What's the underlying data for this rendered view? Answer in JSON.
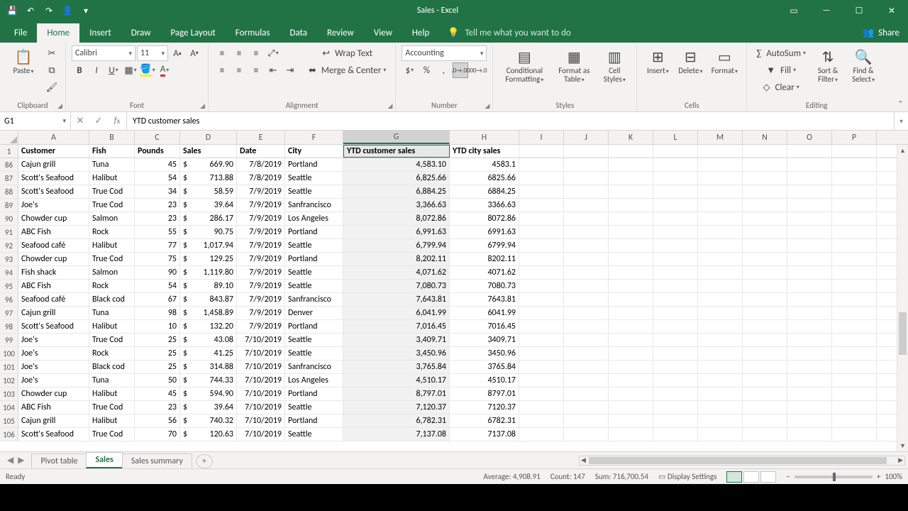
{
  "title": "Sales  -  Excel",
  "qat": {
    "save": "💾",
    "undo": "↶",
    "redo": "↷",
    "user": "👤"
  },
  "winbuttons": {
    "ribbon_opts": "▭",
    "min": "—",
    "max": "☐",
    "close": "✕"
  },
  "tabs": [
    "File",
    "Home",
    "Insert",
    "Draw",
    "Page Layout",
    "Formulas",
    "Data",
    "Review",
    "View",
    "Help"
  ],
  "active_tab": "Home",
  "tell_me": "Tell me what you want to do",
  "share": "Share",
  "ribbon": {
    "clipboard": {
      "label": "Clipboard",
      "paste": "Paste"
    },
    "font": {
      "label": "Font",
      "name": "Calibri",
      "size": "11"
    },
    "alignment": {
      "label": "Alignment",
      "wrap": "Wrap Text",
      "merge": "Merge & Center"
    },
    "number": {
      "label": "Number",
      "format": "Accounting"
    },
    "styles": {
      "label": "Styles",
      "cond": "Conditional Formatting",
      "fat": "Format as Table",
      "cstyle": "Cell Styles"
    },
    "cells": {
      "label": "Cells",
      "insert": "Insert",
      "delete": "Delete",
      "format": "Format"
    },
    "editing": {
      "label": "Editing",
      "autosum": "AutoSum",
      "fill": "Fill",
      "clear": "Clear",
      "sort": "Sort & Filter",
      "find": "Find & Select"
    }
  },
  "namebox": "G1",
  "formula": "YTD customer sales",
  "columns": [
    "A",
    "B",
    "C",
    "D",
    "E",
    "F",
    "G",
    "H",
    "I",
    "J",
    "K",
    "L",
    "M",
    "N",
    "O",
    "P"
  ],
  "selected_col": "G",
  "header_row_num": "1",
  "headers": [
    "Customer",
    "Fish",
    "Pounds",
    "Sales",
    "Date",
    "City",
    "YTD customer sales",
    "YTD city sales"
  ],
  "rows": [
    {
      "n": "86",
      "c": [
        "Cajun grill",
        "Tuna",
        "45",
        "$",
        "669.90",
        "7/8/2019",
        "Portland",
        "4,583.10",
        "4583.1"
      ]
    },
    {
      "n": "87",
      "c": [
        "Scott's Seafood",
        "Halibut",
        "54",
        "$",
        "713.88",
        "7/8/2019",
        "Seattle",
        "6,825.66",
        "6825.66"
      ]
    },
    {
      "n": "88",
      "c": [
        "Scott's Seafood",
        "True Cod",
        "34",
        "$",
        "58.59",
        "7/9/2019",
        "Seattle",
        "6,884.25",
        "6884.25"
      ]
    },
    {
      "n": "89",
      "c": [
        "Joe's",
        "True Cod",
        "23",
        "$",
        "39.64",
        "7/9/2019",
        "Sanfrancisco",
        "3,366.63",
        "3366.63"
      ]
    },
    {
      "n": "90",
      "c": [
        "Chowder cup",
        "Salmon",
        "23",
        "$",
        "286.17",
        "7/9/2019",
        "Los Angeles",
        "8,072.86",
        "8072.86"
      ]
    },
    {
      "n": "91",
      "c": [
        "ABC Fish",
        "Rock",
        "55",
        "$",
        "90.75",
        "7/9/2019",
        "Portland",
        "6,991.63",
        "6991.63"
      ]
    },
    {
      "n": "92",
      "c": [
        "Seafood café",
        "Halibut",
        "77",
        "$",
        "1,017.94",
        "7/9/2019",
        "Seattle",
        "6,799.94",
        "6799.94"
      ]
    },
    {
      "n": "93",
      "c": [
        "Chowder cup",
        "True Cod",
        "75",
        "$",
        "129.25",
        "7/9/2019",
        "Portland",
        "8,202.11",
        "8202.11"
      ]
    },
    {
      "n": "94",
      "c": [
        "Fish shack",
        "Salmon",
        "90",
        "$",
        "1,119.80",
        "7/9/2019",
        "Seattle",
        "4,071.62",
        "4071.62"
      ]
    },
    {
      "n": "95",
      "c": [
        "ABC Fish",
        "Rock",
        "54",
        "$",
        "89.10",
        "7/9/2019",
        "Seattle",
        "7,080.73",
        "7080.73"
      ]
    },
    {
      "n": "96",
      "c": [
        "Seafood café",
        "Black cod",
        "67",
        "$",
        "843.87",
        "7/9/2019",
        "Sanfrancisco",
        "7,643.81",
        "7643.81"
      ]
    },
    {
      "n": "97",
      "c": [
        "Cajun grill",
        "Tuna",
        "98",
        "$",
        "1,458.89",
        "7/9/2019",
        "Denver",
        "6,041.99",
        "6041.99"
      ]
    },
    {
      "n": "98",
      "c": [
        "Scott's Seafood",
        "Halibut",
        "10",
        "$",
        "132.20",
        "7/9/2019",
        "Portland",
        "7,016.45",
        "7016.45"
      ]
    },
    {
      "n": "99",
      "c": [
        "Joe's",
        "True Cod",
        "25",
        "$",
        "43.08",
        "7/10/2019",
        "Seattle",
        "3,409.71",
        "3409.71"
      ]
    },
    {
      "n": "100",
      "c": [
        "Joe's",
        "Rock",
        "25",
        "$",
        "41.25",
        "7/10/2019",
        "Seattle",
        "3,450.96",
        "3450.96"
      ]
    },
    {
      "n": "101",
      "c": [
        "Joe's",
        "Black cod",
        "25",
        "$",
        "314.88",
        "7/10/2019",
        "Sanfrancisco",
        "3,765.84",
        "3765.84"
      ]
    },
    {
      "n": "102",
      "c": [
        "Joe's",
        "Tuna",
        "50",
        "$",
        "744.33",
        "7/10/2019",
        "Los Angeles",
        "4,510.17",
        "4510.17"
      ]
    },
    {
      "n": "103",
      "c": [
        "Chowder cup",
        "Halibut",
        "45",
        "$",
        "594.90",
        "7/10/2019",
        "Portland",
        "8,797.01",
        "8797.01"
      ]
    },
    {
      "n": "104",
      "c": [
        "ABC Fish",
        "True Cod",
        "23",
        "$",
        "39.64",
        "7/10/2019",
        "Seattle",
        "7,120.37",
        "7120.37"
      ]
    },
    {
      "n": "105",
      "c": [
        "Cajun grill",
        "Halibut",
        "56",
        "$",
        "740.32",
        "7/10/2019",
        "Portland",
        "6,782.31",
        "6782.31"
      ]
    },
    {
      "n": "106",
      "c": [
        "Scott's Seafood",
        "True Cod",
        "70",
        "$",
        "120.63",
        "7/10/2019",
        "Seattle",
        "7,137.08",
        "7137.08"
      ]
    }
  ],
  "sheets": [
    "Pivot table",
    "Sales",
    "Sales summary"
  ],
  "active_sheet": "Sales",
  "status": {
    "ready": "Ready",
    "avg": "Average: 4,908.91",
    "count": "Count: 147",
    "sum": "Sum: 716,700.54",
    "display": "Display Settings",
    "zoom": "100%"
  }
}
